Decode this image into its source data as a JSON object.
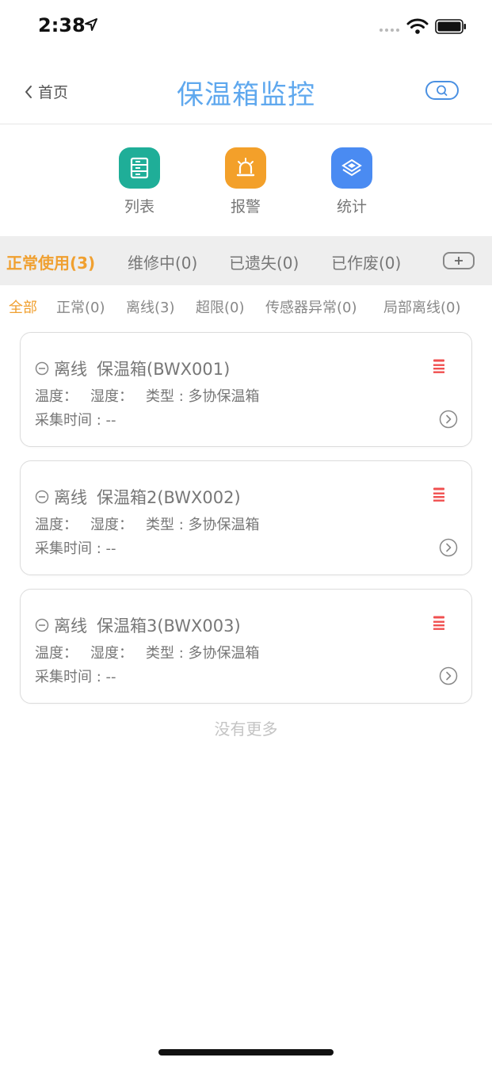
{
  "status_bar": {
    "time": "2:38"
  },
  "nav": {
    "back_label": "首页",
    "title": "保温箱监控"
  },
  "actions": [
    {
      "label": "列表",
      "icon": "list-icon",
      "color": "#1fae98"
    },
    {
      "label": "报警",
      "icon": "alarm-icon",
      "color": "#f3a02a"
    },
    {
      "label": "统计",
      "icon": "layers-icon",
      "color": "#4a8bf2"
    }
  ],
  "tabs": [
    {
      "label": "正常使用(3)",
      "active": true
    },
    {
      "label": "维修中(0)"
    },
    {
      "label": "已遗失(0)"
    },
    {
      "label": "已作废(0)"
    }
  ],
  "filters": [
    {
      "label": "全部",
      "active": true
    },
    {
      "label": "正常(0)"
    },
    {
      "label": "离线(3)"
    },
    {
      "label": "超限(0)"
    },
    {
      "label": "传感器异常(0)"
    },
    {
      "label": "局部离线(0)"
    }
  ],
  "devices": [
    {
      "status": "离线",
      "name": "保温箱(BWX001)",
      "temp_label": "温度：",
      "humidity_label": "湿度：",
      "type": "类型 : 多协保温箱",
      "collect_time": "采集时间 : --"
    },
    {
      "status": "离线",
      "name": "保温箱2(BWX002)",
      "temp_label": "温度：",
      "humidity_label": "湿度：",
      "type": "类型 : 多协保温箱",
      "collect_time": "采集时间 : --"
    },
    {
      "status": "离线",
      "name": "保温箱3(BWX003)",
      "temp_label": "温度：",
      "humidity_label": "湿度：",
      "type": "类型 : 多协保温箱",
      "collect_time": "采集时间 : --"
    }
  ],
  "footer": {
    "no_more": "没有更多"
  },
  "colors": {
    "accent": "#f0a030",
    "title": "#5fa8ee",
    "delete": "#f05050"
  }
}
